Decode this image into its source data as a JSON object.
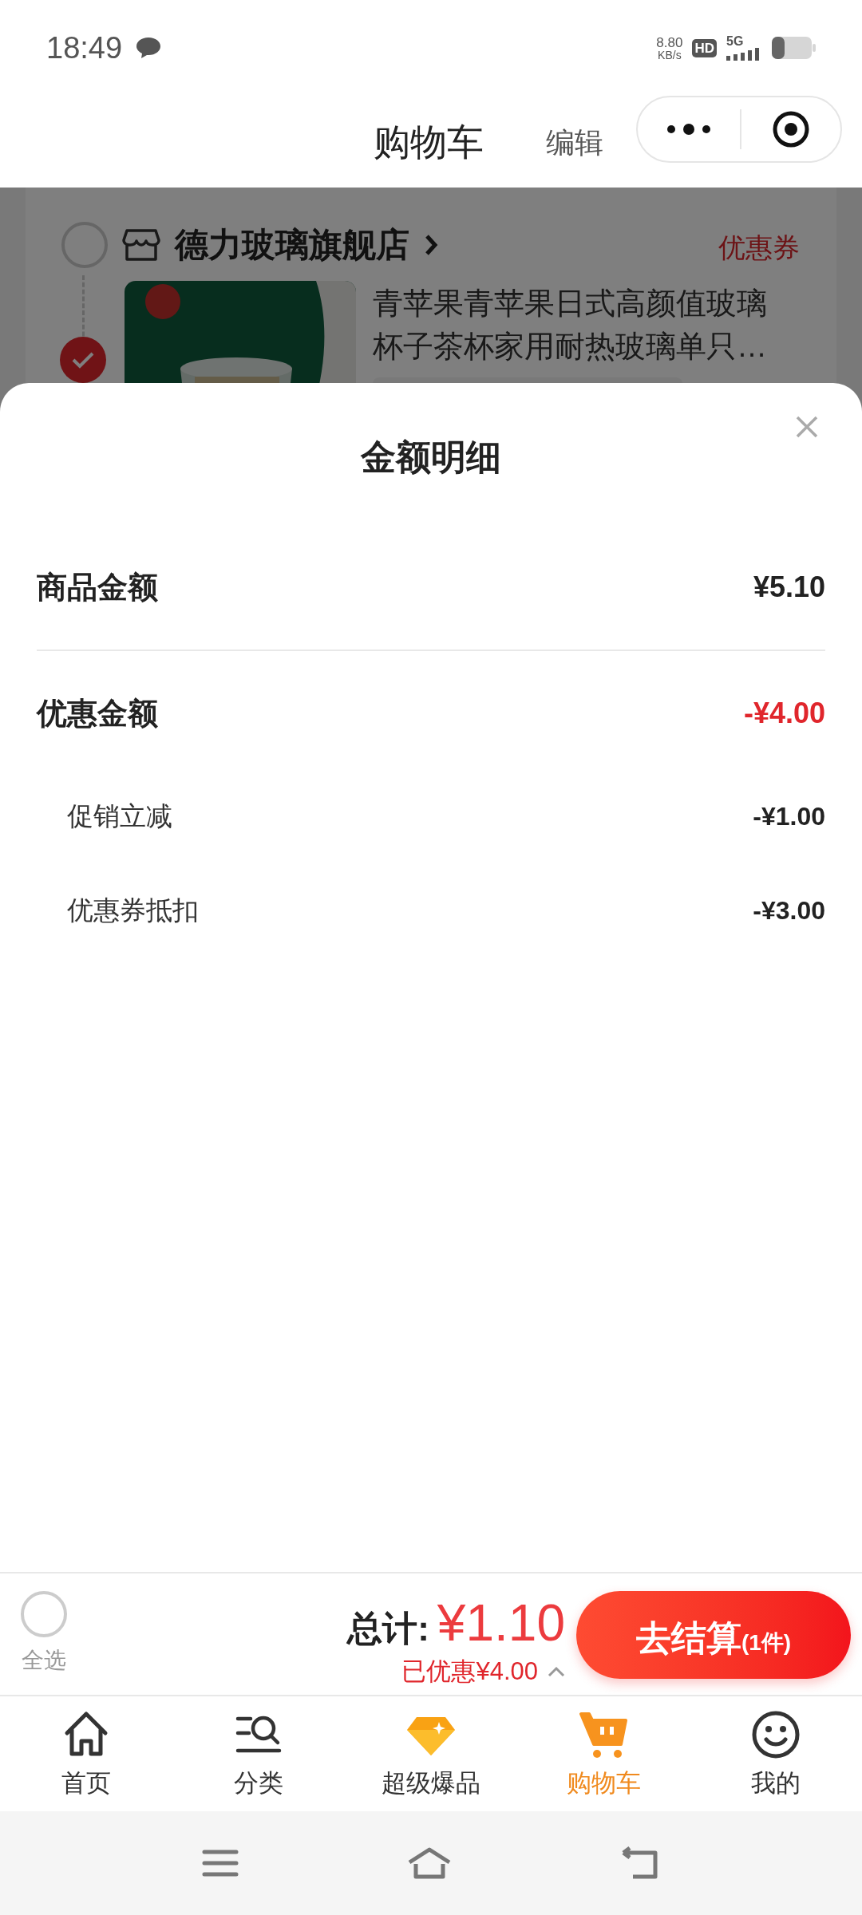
{
  "status_bar": {
    "time": "18:49",
    "net_speed": "8.80",
    "net_unit": "KB/s",
    "hd": "HD",
    "network": "5G"
  },
  "header": {
    "title": "购物车",
    "edit": "编辑"
  },
  "store": {
    "name": "德力玻璃旗舰店",
    "checked": false,
    "coupon": "优惠券",
    "items": [
      {
        "title": "青苹果青苹果日式高颜值玻璃杯子茶杯家用耐热玻璃单只…",
        "checked": true
      }
    ]
  },
  "sheet": {
    "title": "金额明细",
    "rows": [
      {
        "kind": "main",
        "label": "商品金额",
        "value": "¥5.10",
        "highlight": false,
        "divider_after": true
      },
      {
        "kind": "main",
        "label": "优惠金额",
        "value": "-¥4.00",
        "highlight": true,
        "divider_after": false
      },
      {
        "kind": "sub",
        "label": "促销立减",
        "value": "-¥1.00",
        "highlight": false,
        "divider_after": false
      },
      {
        "kind": "sub",
        "label": "优惠券抵扣",
        "value": "-¥3.00",
        "highlight": false,
        "divider_after": false
      }
    ]
  },
  "footer": {
    "select_all": {
      "label": "全选",
      "checked": false
    },
    "total_label": "总计:",
    "total": "¥1.10",
    "saved": "已优惠¥4.00",
    "checkout": {
      "label": "去结算",
      "count": "(1件)"
    }
  },
  "tabs": [
    {
      "label": "首页",
      "selected": false
    },
    {
      "label": "分类",
      "selected": false
    },
    {
      "label": "超级爆品",
      "selected": false
    },
    {
      "label": "购物车",
      "selected": true
    },
    {
      "label": "我的",
      "selected": false
    }
  ]
}
